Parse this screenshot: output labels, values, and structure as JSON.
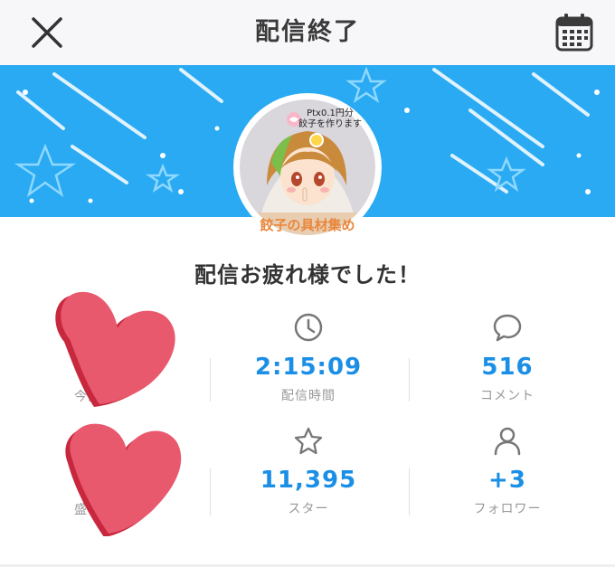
{
  "header": {
    "title": "配信終了",
    "close_icon": "close-icon",
    "calendar_icon": "calendar-icon"
  },
  "avatar": {
    "caption_line1": "Ptx0.1円分",
    "caption_line2": "餃子を作ります",
    "banner_text": "餃子の具材集め"
  },
  "message": "配信お疲れ様でした！",
  "stats": [
    {
      "icon": "clock-icon",
      "value": "2:15:09",
      "label": "配信時間"
    },
    {
      "icon": "speech-bubble-icon",
      "value": "516",
      "label": "コメント"
    },
    {
      "icon": "star-icon",
      "value": "11,395",
      "label": "スター"
    },
    {
      "icon": "user-icon",
      "value": "+3",
      "label": "フォロワー"
    }
  ],
  "redacted": {
    "left_top_label_partial": "今日",
    "left_bottom_label_partial": "盛"
  },
  "colors": {
    "banner": "#29aaf2",
    "accent": "#1b8fe6",
    "heart": "#e8596e"
  }
}
